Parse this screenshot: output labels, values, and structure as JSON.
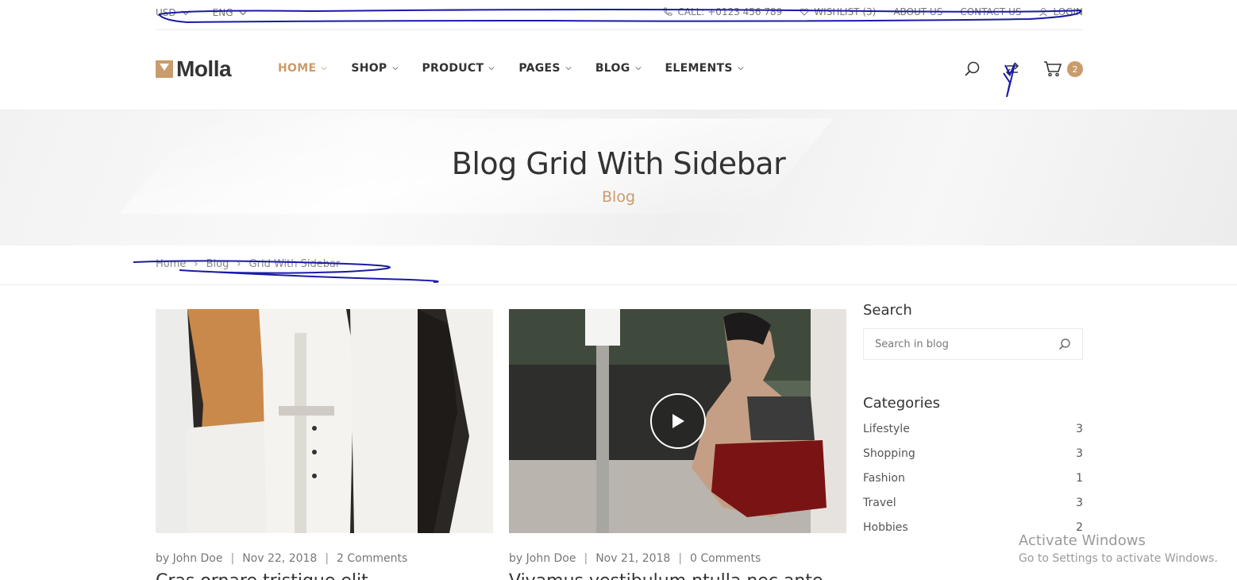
{
  "topbar": {
    "currency": "USD",
    "language": "ENG",
    "call": "CALL: +0123 456 789",
    "wishlist": "WISHLIST (3)",
    "about": "ABOUT US",
    "contact": "CONTACT US",
    "login": "LOGIN"
  },
  "header": {
    "logo": "Molla",
    "nav": [
      "HOME",
      "SHOP",
      "PRODUCT",
      "PAGES",
      "BLOG",
      "ELEMENTS"
    ],
    "cart_count": "2"
  },
  "banner": {
    "title": "Blog Grid With Sidebar",
    "subtitle": "Blog"
  },
  "breadcrumb": [
    "Home",
    "Blog",
    "Grid With Sidebar"
  ],
  "posts": [
    {
      "author": "by John Doe",
      "date": "Nov 22, 2018",
      "comments": "2 Comments",
      "title": "Cras ornare tristique elit."
    },
    {
      "author": "by John Doe",
      "date": "Nov 21, 2018",
      "comments": "0 Comments",
      "title": "Vivamus vestibulum ntulla nec ante."
    }
  ],
  "sidebar": {
    "search_title": "Search",
    "search_placeholder": "Search in blog",
    "categories_title": "Categories",
    "categories": [
      {
        "name": "Lifestyle",
        "count": "3"
      },
      {
        "name": "Shopping",
        "count": "3"
      },
      {
        "name": "Fashion",
        "count": "1"
      },
      {
        "name": "Travel",
        "count": "3"
      },
      {
        "name": "Hobbies",
        "count": "2"
      }
    ]
  },
  "watermark": {
    "line1": "Activate Windows",
    "line2": "Go to Settings to activate Windows."
  },
  "colors": {
    "accent": "#c99c6c",
    "annotation": "#1a1aa8"
  }
}
